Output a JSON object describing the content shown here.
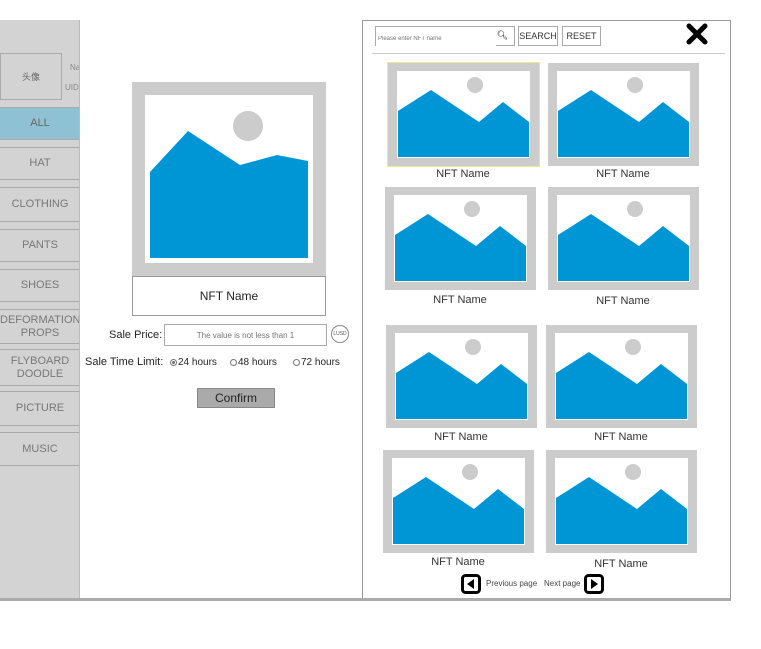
{
  "sidebar": {
    "avatar": "头像",
    "name_label": "Na",
    "uid_label": "UID",
    "items": [
      {
        "label": "ALL",
        "active": true
      },
      {
        "label": "HAT"
      },
      {
        "label": "CLOTHING"
      },
      {
        "label": "PANTS"
      },
      {
        "label": "SHOES"
      },
      {
        "label": "DEFORMATION PROPS"
      },
      {
        "label": "FLYBOARD DOODLE"
      },
      {
        "label": "PICTURE"
      },
      {
        "label": "MUSIC"
      }
    ]
  },
  "sell": {
    "nft_name": "NFT Name",
    "price_label": "Sale Price:",
    "price_placeholder": "The value is not less than 1",
    "currency": "LUSD",
    "time_label": "Sale Time Limit:",
    "options": [
      "24 hours",
      "48 hours",
      "72 hours"
    ],
    "selected": "24 hours",
    "confirm": "Confirm"
  },
  "market": {
    "search_placeholder": "Please enter NFT name",
    "search": "SEARCH",
    "reset": "RESET",
    "items": [
      "NFT Name",
      "NFT Name",
      "NFT Name",
      "NFT Name",
      "NFT Name",
      "NFT Name",
      "NFT Name",
      "NFT Name"
    ],
    "selected_index": 0,
    "prev": "Previous page",
    "next": "Next page"
  },
  "colors": {
    "accent": "#8fc1d4",
    "image": "#0096d6",
    "selected_border": "#f0e68c"
  }
}
